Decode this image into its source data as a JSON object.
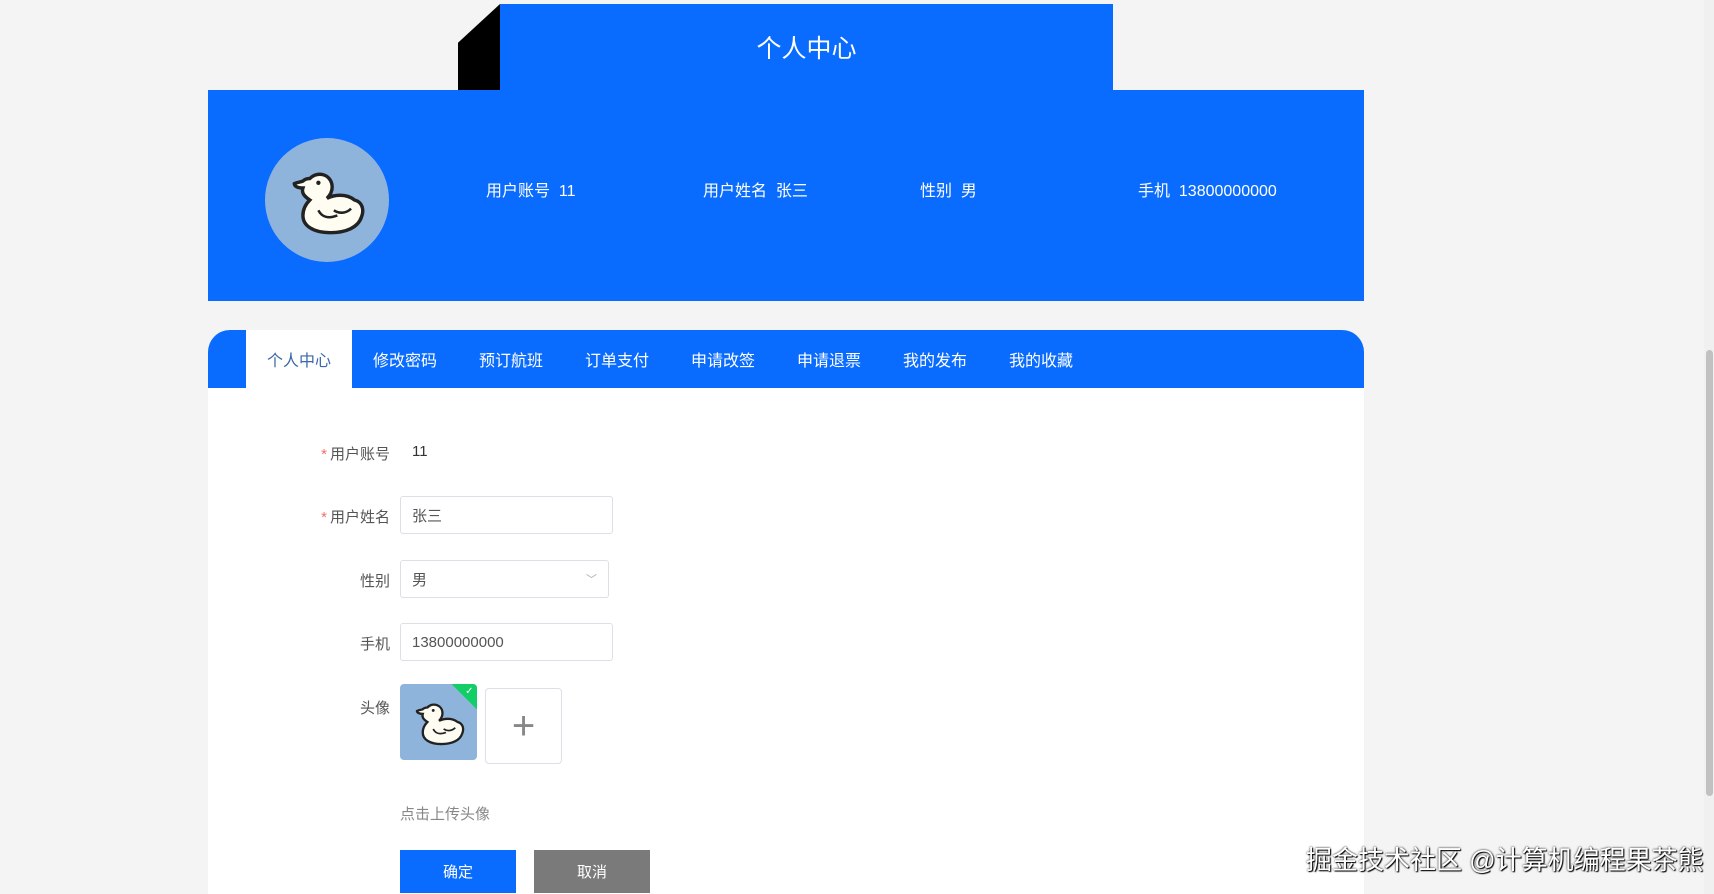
{
  "header": {
    "title": "个人中心"
  },
  "profile": {
    "account_label": "用户账号",
    "account": "11",
    "name_label": "用户姓名",
    "name": "张三",
    "gender_label": "性别",
    "gender": "男",
    "phone_label": "手机",
    "phone": "13800000000"
  },
  "tabs": [
    "个人中心",
    "修改密码",
    "预订航班",
    "订单支付",
    "申请改签",
    "申请退票",
    "我的发布",
    "我的收藏"
  ],
  "form": {
    "account_label": "用户账号",
    "account_value": "11",
    "name_label": "用户姓名",
    "name_value": "张三",
    "gender_label": "性别",
    "gender_value": "男",
    "phone_label": "手机",
    "phone_value": "13800000000",
    "avatar_label": "头像",
    "upload_hint": "点击上传头像",
    "confirm": "确定",
    "cancel": "取消"
  },
  "watermark": "掘金技术社区 @计算机编程果茶熊",
  "colors": {
    "primary": "#0a6cff",
    "cancel": "#7a7a7a",
    "success": "#13ce66"
  }
}
